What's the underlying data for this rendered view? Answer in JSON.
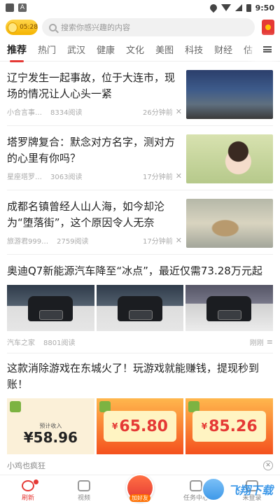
{
  "status": {
    "time": "9:50",
    "a_label": "A"
  },
  "header": {
    "coin_badge": "05:28",
    "search_placeholder": "搜索你感兴趣的内容"
  },
  "tabs": [
    "推荐",
    "热门",
    "武汉",
    "健康",
    "文化",
    "美图",
    "科技",
    "财经",
    "估"
  ],
  "news": [
    {
      "title": "辽宁发生一起事故，位于大连市，现场的情况让人心头一紧",
      "source": "小合言事…",
      "reads": "8334阅读",
      "time": "26分钟前"
    },
    {
      "title": "塔罗牌复合：默念对方名字，测对方的心里有你吗？",
      "source": "星座塔罗…",
      "reads": "3063阅读",
      "time": "17分钟前"
    },
    {
      "title": "成都名镇曾经人山人海，如今却沦为“堕落街”，这个原因令人无奈",
      "source": "旅游君999…",
      "reads": "2759阅读",
      "time": "17分钟前"
    }
  ],
  "car_news": {
    "title": "奥迪Q7新能源汽车降至“冰点”，最近仅需73.28万元起",
    "source": "汽车之家",
    "reads": "8801阅读",
    "time": "刚刚"
  },
  "ad": {
    "title": "这款消除游戏在东城火了！玩游戏就能赚钱，提现秒到账！",
    "source": "小鸡也疯狂",
    "card1_label": "预计收入",
    "card1_amount": "58.96",
    "card2_amount": "65.80",
    "card3_amount": "85.26",
    "currency": "¥"
  },
  "bottom_nav": {
    "home": "刷新",
    "video": "视频",
    "gift": "加好友",
    "tasks": "任务中心",
    "mine": "未登录"
  },
  "watermark": "飞翔下载",
  "colors": {
    "accent": "#e53935",
    "tab_indicator": "#e53935"
  }
}
